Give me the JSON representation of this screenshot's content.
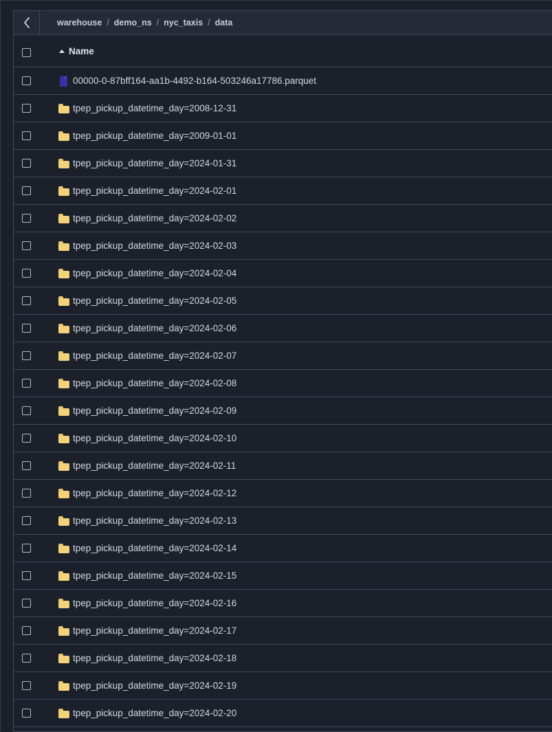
{
  "breadcrumb": [
    "warehouse",
    "demo_ns",
    "nyc_taxis",
    "data"
  ],
  "table": {
    "column_name": "Name",
    "sort": "ascending",
    "rows": [
      {
        "type": "file",
        "name": "00000-0-87bff164-aa1b-4492-b164-503246a17786.parquet"
      },
      {
        "type": "folder",
        "name": "tpep_pickup_datetime_day=2008-12-31"
      },
      {
        "type": "folder",
        "name": "tpep_pickup_datetime_day=2009-01-01"
      },
      {
        "type": "folder",
        "name": "tpep_pickup_datetime_day=2024-01-31"
      },
      {
        "type": "folder",
        "name": "tpep_pickup_datetime_day=2024-02-01"
      },
      {
        "type": "folder",
        "name": "tpep_pickup_datetime_day=2024-02-02"
      },
      {
        "type": "folder",
        "name": "tpep_pickup_datetime_day=2024-02-03"
      },
      {
        "type": "folder",
        "name": "tpep_pickup_datetime_day=2024-02-04"
      },
      {
        "type": "folder",
        "name": "tpep_pickup_datetime_day=2024-02-05"
      },
      {
        "type": "folder",
        "name": "tpep_pickup_datetime_day=2024-02-06"
      },
      {
        "type": "folder",
        "name": "tpep_pickup_datetime_day=2024-02-07"
      },
      {
        "type": "folder",
        "name": "tpep_pickup_datetime_day=2024-02-08"
      },
      {
        "type": "folder",
        "name": "tpep_pickup_datetime_day=2024-02-09"
      },
      {
        "type": "folder",
        "name": "tpep_pickup_datetime_day=2024-02-10"
      },
      {
        "type": "folder",
        "name": "tpep_pickup_datetime_day=2024-02-11"
      },
      {
        "type": "folder",
        "name": "tpep_pickup_datetime_day=2024-02-12"
      },
      {
        "type": "folder",
        "name": "tpep_pickup_datetime_day=2024-02-13"
      },
      {
        "type": "folder",
        "name": "tpep_pickup_datetime_day=2024-02-14"
      },
      {
        "type": "folder",
        "name": "tpep_pickup_datetime_day=2024-02-15"
      },
      {
        "type": "folder",
        "name": "tpep_pickup_datetime_day=2024-02-16"
      },
      {
        "type": "folder",
        "name": "tpep_pickup_datetime_day=2024-02-17"
      },
      {
        "type": "folder",
        "name": "tpep_pickup_datetime_day=2024-02-18"
      },
      {
        "type": "folder",
        "name": "tpep_pickup_datetime_day=2024-02-19"
      },
      {
        "type": "folder",
        "name": "tpep_pickup_datetime_day=2024-02-20"
      }
    ]
  },
  "icons": {
    "back": "chevron-left-icon",
    "sort": "sort-ascending-icon",
    "folder": "folder-icon",
    "file": "file-icon"
  },
  "colors": {
    "background": "#1c202b",
    "topbar": "#252a36",
    "border": "#414858",
    "folder": "#f2d37c",
    "file": "#3a2fa8"
  }
}
